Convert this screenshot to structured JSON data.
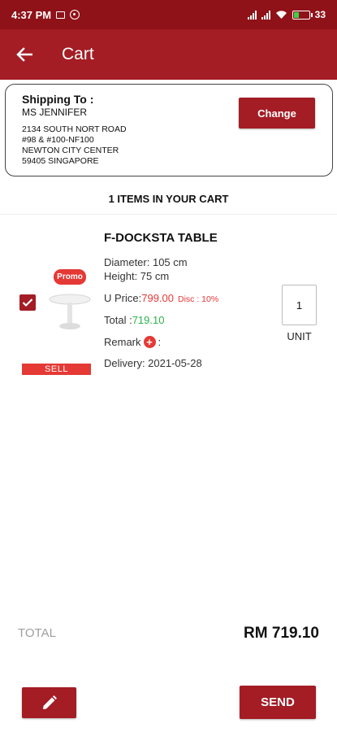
{
  "status_bar": {
    "time": "4:37 PM",
    "battery": "33"
  },
  "app_bar": {
    "title": "Cart"
  },
  "shipping": {
    "heading": "Shipping To :",
    "name": "MS JENNIFER",
    "address_lines": [
      "2134 SOUTH NORT ROAD",
      "#98 & #100-NF100",
      "NEWTON CITY CENTER",
      "59405 SINGAPORE"
    ],
    "change_label": "Change"
  },
  "cart": {
    "count_label": "1 ITEMS IN YOUR CART",
    "item": {
      "promo": "Promo",
      "sell": "SELL",
      "name": "F-DOCKSTA TABLE",
      "diameter": "Diameter: 105 cm",
      "height": "Height: 75 cm",
      "uprice_label": "U Price:",
      "uprice": "799.00",
      "disc": "Disc : 10%",
      "total_label": "Total :",
      "total": "719.10",
      "remark_label": "Remark",
      "remark_colon": ":",
      "delivery": "Delivery: 2021-05-28",
      "qty": "1",
      "unit": "UNIT",
      "checked": true
    }
  },
  "footer": {
    "total_label": "TOTAL",
    "total_amount": "RM 719.10",
    "send_label": "SEND"
  },
  "colors": {
    "primary": "#a41c24",
    "status_bar": "#8e1218",
    "accent_red": "#e53935",
    "accent_green": "#2bb34a"
  }
}
